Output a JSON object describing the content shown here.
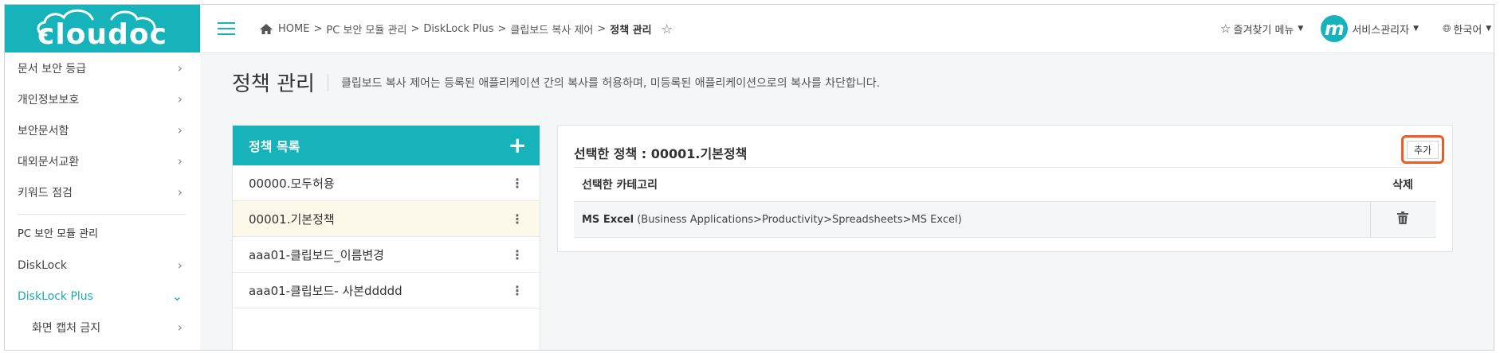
{
  "logo": {
    "text": "cloudoc"
  },
  "sidebar": {
    "items": [
      {
        "label": "문서 보안 등급",
        "chevron": "›"
      },
      {
        "label": "개인정보보호",
        "chevron": "›"
      },
      {
        "label": "보안문서함",
        "chevron": "›"
      },
      {
        "label": "대외문서교환",
        "chevron": "›"
      },
      {
        "label": "키워드 점검",
        "chevron": "›"
      }
    ],
    "section_title": "PC 보안 모듈 관리",
    "section_items": [
      {
        "label": "DiskLock",
        "chevron": "›"
      },
      {
        "label": "DiskLock Plus",
        "chevron": "⌄"
      }
    ],
    "sub_items": [
      {
        "label": "화면 캡처 금지",
        "chevron": "›"
      }
    ]
  },
  "breadcrumb": {
    "items": [
      "HOME",
      "PC 보안 모듈 관리",
      "DiskLock Plus",
      "클립보드 복사 제어"
    ],
    "current": "정책 관리",
    "separator": ">"
  },
  "topbar": {
    "favorites_label": "즐겨찾기 메뉴",
    "user_initial": "m",
    "user_name": "서비스관리자",
    "language": "한국어"
  },
  "page": {
    "title": "정책 관리",
    "description": "클립보드 복사 제어는 등록된 애플리케이션 간의 복사를 허용하며, 미등록된 애플리케이션으로의 복사를 차단합니다."
  },
  "policy_list": {
    "header": "정책 목록",
    "add_symbol": "+",
    "items": [
      {
        "label": "00000.모두허용"
      },
      {
        "label": "00001.기본정책"
      },
      {
        "label": "aaa01-클립보드_이름변경"
      },
      {
        "label": "aaa01-클립보드- 사본ddddd"
      }
    ],
    "menu_symbol": "⋮"
  },
  "detail": {
    "title": "선택한 정책 : 00001.기본정책",
    "add_label": "추가",
    "columns": {
      "category": "선택한 카테고리",
      "delete": "삭제"
    },
    "rows": [
      {
        "app": "MS Excel",
        "path": "(Business Applications>Productivity>Spreadsheets>MS Excel)"
      }
    ]
  },
  "colors": {
    "accent": "#16b3bb",
    "highlight": "#f15a24",
    "selected_row": "#fdf9ea"
  }
}
